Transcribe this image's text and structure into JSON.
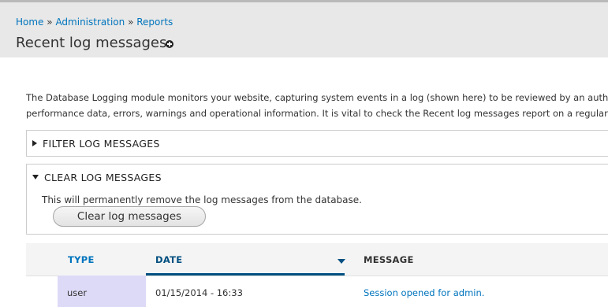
{
  "breadcrumb": {
    "items": [
      "Home",
      "Administration",
      "Reports"
    ],
    "separator": "»"
  },
  "page": {
    "title": "Recent log messages",
    "shortcut_icon": "plus-circle-icon"
  },
  "description": {
    "line1": "The Database Logging module monitors your website, capturing system events in a log (shown here) to be reviewed by an autho",
    "line2": "performance data, errors, warnings and operational information. It is vital to check the Recent log messages report on a regular"
  },
  "filter_fieldset": {
    "legend": "FILTER LOG MESSAGES",
    "collapsed": true
  },
  "clear_fieldset": {
    "legend": "CLEAR LOG MESSAGES",
    "collapsed": false,
    "text": "This will permanently remove the log messages from the database.",
    "button_label": "Clear log messages"
  },
  "table": {
    "headers": {
      "type": "TYPE",
      "date": "DATE",
      "message": "MESSAGE"
    },
    "sort_column": "date",
    "sort_direction": "desc",
    "rows": [
      {
        "type": "user",
        "date": "01/15/2014 - 16:33",
        "message": "Session opened for admin."
      }
    ]
  },
  "colors": {
    "link": "#0074bd",
    "header_bg": "#e8e8e8",
    "type_cell_bg": "#dddaf7",
    "active_sort": "#004f80"
  }
}
